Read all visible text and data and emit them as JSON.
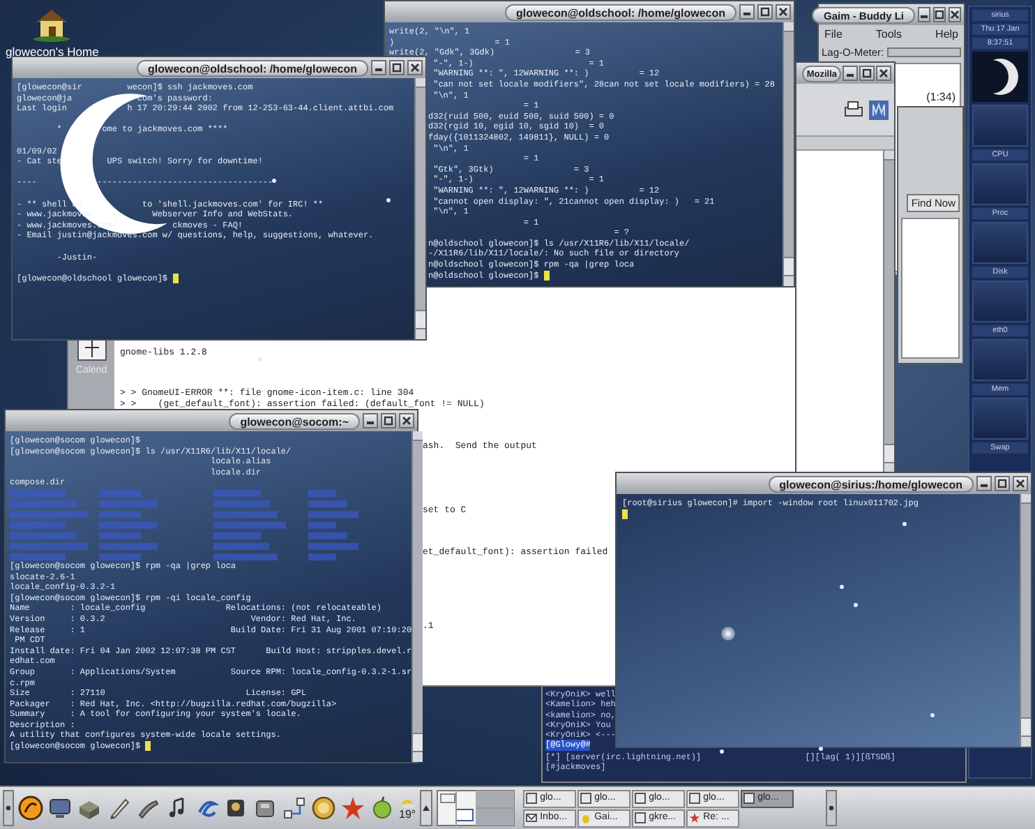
{
  "desktop_icon": {
    "label": "glowecon's Home"
  },
  "document_window": {
    "launcher_label": "Calend",
    "lines": [
      "gnome-libs 1.2.8",
      "> > GnomeUI-ERROR **: file gnome-icon-item.c: line 304",
      "> >    (get_default_font): assertion failed: (default_font != NULL)"
    ],
    "tail_lines": [
      "ash.  Send the output",
      "set to C",
      "et_default_font): assertion failed",
      ".1"
    ]
  },
  "strace_terminal": {
    "title": "glowecon@oldschool: /home/glowecon",
    "lines_top": [
      "write(2, \"\\n\", 1",
      ")                    = 1",
      "write(2, \"Gdk\", 3Gdk)                = 3"
    ],
    "lines": [
      " \"-\", 1-)                       = 1",
      " \"WARNING **: \", 12WARNING **: )          = 12",
      " \"can not set locale modifiers\", 28can not set locale modifiers) = 28",
      " \"\\n\", 1",
      "                   = 1",
      "d32(ruid 500, euid 500, suid 500) = 0",
      "d32(rgid 10, egid 10, sgid 10)  = 0",
      "fday({1011324802, 149811}, NULL) = 0",
      " \"\\n\", 1",
      "                   = 1",
      " \"Gtk\", 3Gtk)                = 3",
      " \"-\", 1-)                       = 1",
      " \"WARNING **: \", 12WARNING **: )          = 12",
      " \"cannot open display: \", 21cannot open display: )   = 21",
      " \"\\n\", 1",
      "                   = 1",
      "                                     = ?",
      "n@oldschool glowecon]$ ls /usr/X11R6/lib/X11/locale/",
      "-/X11R6/lib/X11/locale/: No such file or directory",
      "n@oldschool glowecon]$ rpm -qa |grep loca"
    ],
    "prompt": "n@oldschool glowecon]$ ",
    "cursor": true
  },
  "gaim_window": {
    "title": "Gaim - Buddy Li",
    "menu": [
      "File",
      "Tools",
      "Help"
    ],
    "lag_label": "Lag-O-Meter:",
    "idle": "(1:34)"
  },
  "search_window": {
    "button": "Find Now"
  },
  "mozilla_window": {
    "title": "Mozilla"
  },
  "gkrellm": {
    "hostname": "sirius",
    "date": "Thu 17 Jan",
    "time": "8:37:51",
    "panels": [
      "CPU",
      "Proc",
      "Disk",
      "eth0",
      "Mem",
      "Swap"
    ]
  },
  "ssh_terminal": {
    "title": "glowecon@oldschool: /home/glowecon",
    "blocks": [
      [
        "[glowecon@sir         wecon]$ ssh jackmoves.com",
        "glowecon@ja             com's password:",
        "Last login            h 17 20:29:44 2002 from 12-253-63-44.client.attbi.com"
      ],
      [
        "        *        ome to jackmoves.com ****"
      ],
      [
        "01/09/02",
        "- Cat ste         UPS switch! Sorry for downtime!"
      ],
      [
        "----          -------------------------------------"
      ],
      [
        "- ** shell us            to 'shell.jackmoves.com' for IRC! **",
        "- www.jackmoves.           Webserver Info and WebStats.",
        "- www.jackmoves.com/           ckmoves - FAQ!",
        "- Email justin@jackmoves.com w/ questions, help, suggestions, whatever."
      ],
      [
        "        -Justin-"
      ]
    ],
    "prompt": "[glowecon@oldschool glowecon]$ ",
    "cursor": true
  },
  "socom_terminal": {
    "title": "glowecon@socom:~",
    "lines_before": [
      "[glowecon@socom glowecon]$",
      "[glowecon@socom glowecon]$ ls /usr/X11R6/lib/X11/locale/",
      "                                        locale.alias",
      "                                        locale.dir",
      "compose.dir"
    ],
    "lines_after": [
      "[glowecon@socom glowecon]$ rpm -qa |grep loca",
      "slocate-2.6-1",
      "locale_config-0.3.2-1",
      "[glowecon@socom glowecon]$ rpm -qi locale_config",
      "Name        : locale_config                Relocations: (not relocateable)",
      "Version     : 0.3.2                             Vendor: Red Hat, Inc.",
      "Release     : 1                             Build Date: Fri 31 Aug 2001 07:10:20",
      " PM CDT",
      "Install date: Fri 04 Jan 2002 12:07:38 PM CST      Build Host: stripples.devel.r",
      "edhat.com",
      "Group       : Applications/System           Source RPM: locale_config-0.3.2-1.sr",
      "c.rpm",
      "Size        : 27110                            License: GPL",
      "Packager    : Red Hat, Inc. <http://bugzilla.redhat.com/bugzilla>",
      "Summary     : A tool for configuring your system's locale.",
      "Description :",
      "A utility that configures system-wide locale settings."
    ],
    "prompt": "[glowecon@socom glowecon]$ ",
    "cursor": true
  },
  "irc_window": {
    "messages": [
      "<KryOniK> well",
      "<Kamelion> heh",
      "<kamelion> no,",
      "<KryOniK> You",
      "<KryOniK> <---"
    ],
    "channel_line": "[@Glowy@#",
    "status_left": "[*] [server(irc.lightning.net)]",
    "status_right": "[][lag( 1)][ßTSDß]",
    "input": "[#jackmoves]"
  },
  "sirius_terminal": {
    "title": "glowecon@sirius:/home/glowecon",
    "lines": [
      "[root@sirius glowecon]# import -window root linux011702.jpg"
    ],
    "cursor": true
  },
  "taskbar": {
    "weather": "19°",
    "tasks": [
      {
        "label": "glo...",
        "kind": "window",
        "selected": false
      },
      {
        "label": "glo...",
        "kind": "window",
        "selected": false
      },
      {
        "label": "glo...",
        "kind": "window",
        "selected": false
      },
      {
        "label": "glo...",
        "kind": "window",
        "selected": false
      },
      {
        "label": "glo...",
        "kind": "window",
        "selected": true
      },
      {
        "label": "Inbo...",
        "kind": "mail",
        "selected": false
      },
      {
        "label": "Gai...",
        "kind": "chat",
        "selected": false
      },
      {
        "label": "gkre...",
        "kind": "window",
        "selected": false
      },
      {
        "label": "Re: ...",
        "kind": "news",
        "selected": false
      }
    ]
  }
}
